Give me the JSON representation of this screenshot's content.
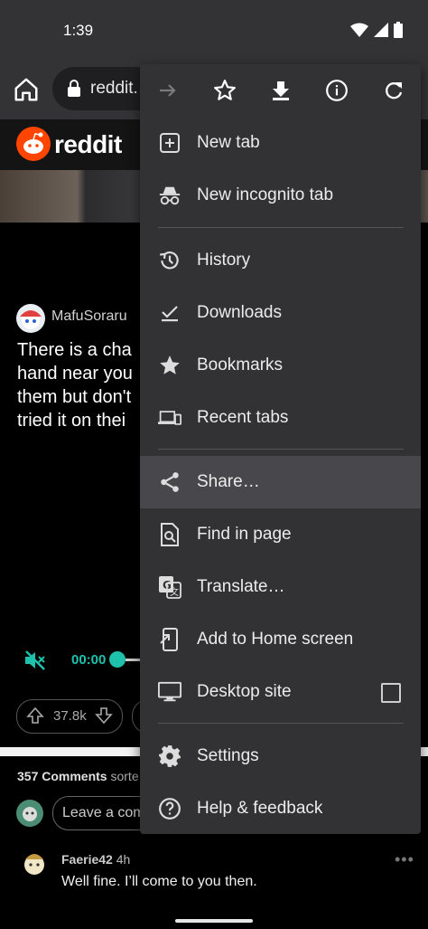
{
  "status": {
    "time": "1:39"
  },
  "toolbar": {
    "url": "reddit."
  },
  "reddit": {
    "brand": "reddit",
    "post": {
      "author": "MafuSoraru",
      "text": "There is a cha\nhand near you\nthem but don't\ntried it on thei"
    },
    "video": {
      "time": "00:00"
    },
    "votes": "37.8k",
    "comments": {
      "count": "357 Comments",
      "sorted": "sorte",
      "leave": "Leave a com",
      "first": {
        "author": "Faerie42",
        "age": "4h",
        "text": "Well fine. I’ll come to you then."
      }
    }
  },
  "menu": {
    "items": [
      {
        "label": "New tab",
        "icon": "new-tab-icon"
      },
      {
        "label": "New incognito tab",
        "icon": "incognito-icon"
      },
      {
        "label": "History",
        "icon": "history-icon"
      },
      {
        "label": "Downloads",
        "icon": "downloads-icon"
      },
      {
        "label": "Bookmarks",
        "icon": "bookmarks-star-icon"
      },
      {
        "label": "Recent tabs",
        "icon": "recent-tabs-icon"
      },
      {
        "label": "Share…",
        "icon": "share-icon"
      },
      {
        "label": "Find in page",
        "icon": "find-in-page-icon"
      },
      {
        "label": "Translate…",
        "icon": "translate-icon"
      },
      {
        "label": "Add to Home screen",
        "icon": "add-to-home-icon"
      },
      {
        "label": "Desktop site",
        "icon": "desktop-icon"
      },
      {
        "label": "Settings",
        "icon": "settings-gear-icon"
      },
      {
        "label": "Help & feedback",
        "icon": "help-icon"
      }
    ],
    "desktop_site_checked": false,
    "highlighted": "Share…"
  },
  "colors": {
    "accent": "#1fc1ad",
    "reddit_orange": "#ff4500",
    "menu_bg": "#323235"
  }
}
